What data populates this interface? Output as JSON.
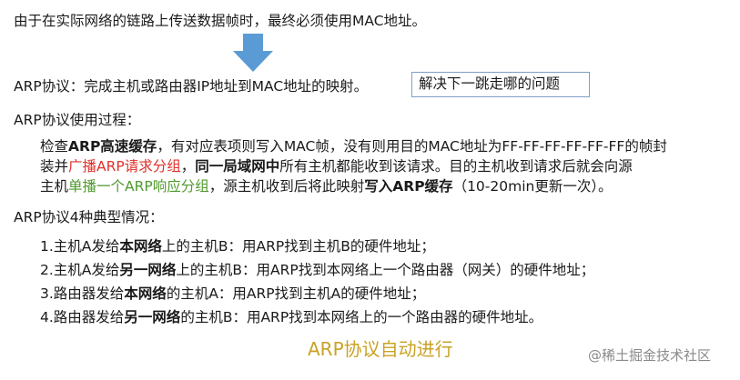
{
  "intro": {
    "text": "由于在实际网络的链路上传送数据帧时，最终必须使用MAC地址。"
  },
  "arp_def": {
    "text": "ARP协议：完成主机或路由器IP地址到MAC地址的映射。",
    "box": "解决下一跳走哪的问题"
  },
  "process": {
    "heading": "ARP协议使用过程：",
    "l1_a": "检查",
    "l1_b": "ARP高速缓存",
    "l1_c": "，有对应表项则写入MAC帧，没有则用目的MAC地址为FF-FF-FF-FF-FF-FF的帧封",
    "l2_a": "装并",
    "l2_b": "广播ARP请求分组",
    "l2_c": "，",
    "l2_d": "同一局域网中",
    "l2_e": "所有主机都能收到该请求。目的主机收到请求后就会向源",
    "l3_a": "主机",
    "l3_b": "单播一个ARP响应分组",
    "l3_c": "，源主机收到后将此映射",
    "l3_d": "写入ARP缓存",
    "l3_e": "（10-20min更新一次）。"
  },
  "cases": {
    "heading": "ARP协议4种典型情况：",
    "items": [
      {
        "pre": "1.主机A发给",
        "bold": "本网络",
        "post": "上的主机B：用ARP找到主机B的硬件地址；"
      },
      {
        "pre": "2.主机A发给",
        "bold": "另一网络",
        "post": "上的主机B：用ARP找到本网络上一个路由器（网关）的硬件地址；"
      },
      {
        "pre": "3.路由器发给",
        "bold": "本网络",
        "post": "的主机A：用ARP找到主机A的硬件地址；"
      },
      {
        "pre": "4.路由器发给",
        "bold": "另一网络",
        "post": "的主机B：用ARP找到本网络上的一个路由器的硬件地址。"
      }
    ]
  },
  "footer": {
    "title": "ARP协议自动进行",
    "watermark": "@稀土掘金技术社区"
  },
  "colors": {
    "arrow": "#5b9bd5",
    "red": "#e0302a",
    "green": "#4f9a2e",
    "gold": "#c9a227",
    "box_border": "#7f9fc6"
  },
  "icons": {
    "arrow": "down-arrow-icon"
  }
}
